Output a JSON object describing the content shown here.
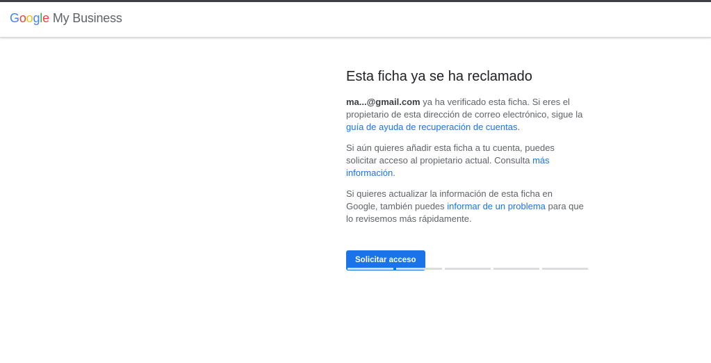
{
  "header": {
    "logo_google_letters": [
      "G",
      "o",
      "o",
      "g",
      "l",
      "e"
    ],
    "logo_colors": [
      "#4285F4",
      "#EA4335",
      "#FBBC05",
      "#4285F4",
      "#34A853",
      "#EA4335"
    ],
    "product_name": "My Business"
  },
  "main": {
    "title": "Esta ficha ya se ha reclamado",
    "para1": {
      "email": "ma...@gmail.com",
      "text1": " ya ha verificado esta ficha. Si eres el propietario de esta dirección de correo electrónico, sigue la ",
      "link": "guía de ayuda de recuperación de cuentas",
      "text2": "."
    },
    "para2": {
      "text1": "Si aún quieres añadir esta ficha a tu cuenta, puedes solicitar acceso al propietario actual. Consulta ",
      "link": "más información",
      "text2": "."
    },
    "para3": {
      "text1": "Si quieres actualizar la información de esta ficha en Google, también puedes ",
      "link": "informar de un problema",
      "text2": " para que lo revisemos más rápidamente."
    },
    "button_label": "Solicitar acceso"
  },
  "progress": {
    "step_count": 5,
    "accent_color": "#1a73e8"
  }
}
